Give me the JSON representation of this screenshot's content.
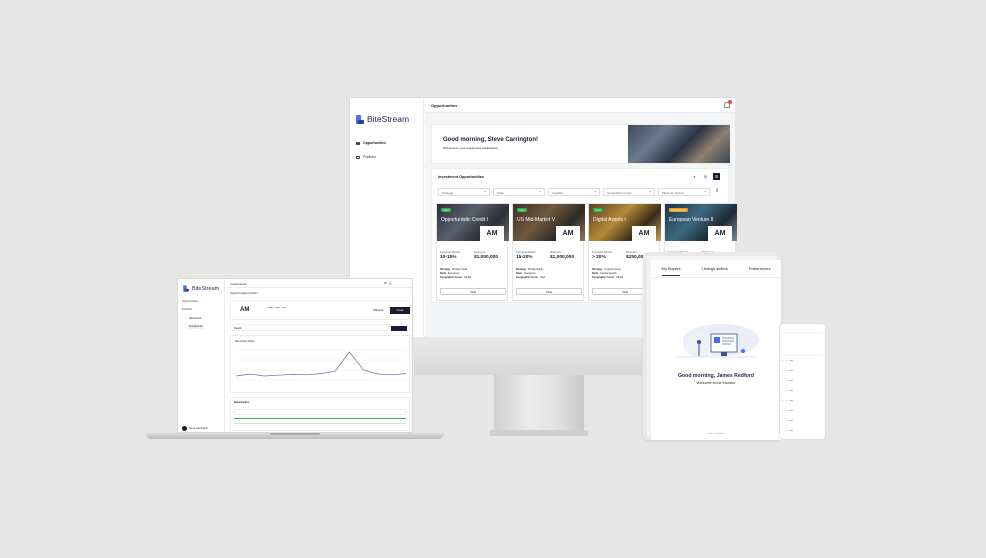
{
  "brand": {
    "name": "BiteStream",
    "accent": "#4a6cf7",
    "dark": "#1a1a2e"
  },
  "desktop": {
    "nav": [
      {
        "label": "Opportunities",
        "active": true
      },
      {
        "label": "Portfolio",
        "active": false
      }
    ],
    "topbar_title": "Opportunities",
    "hero": {
      "title": "Good morning, Steve Carrington!",
      "subtitle": "Welcome to your Investment marketplace"
    },
    "panel_title": "Investment Opportunities",
    "filters": [
      "Strategy",
      "Stats",
      "Liquidity",
      "Geographic Focus",
      "Minimum Return"
    ],
    "labels": {
      "projected_return": "Forecast Return",
      "minimum": "Minimum",
      "strategy": "Strategy",
      "stats": "Stats",
      "geo": "Geographic Focus"
    },
    "cards": [
      {
        "badge": "Open",
        "badge_color": "#2eaa4a",
        "title": "Opportunistic Credit I",
        "logo": "AM",
        "return": "10-15%",
        "minimum": "$1,000,000",
        "strategy": "Private Credit",
        "stats": "Evergreen",
        "geo": "Global",
        "button": "View",
        "img": "linear-gradient(135deg,#2a2f3a,#5a5f6c 40%,#2b2e36 70%,#6d6d6d)"
      },
      {
        "badge": "Open",
        "badge_color": "#2eaa4a",
        "title": "US Mid-Market V",
        "logo": "AM",
        "return": "15-20%",
        "minimum": "$1,000,000",
        "strategy": "Private Equity",
        "stats": "Evergreen",
        "geo": "USA",
        "button": "View",
        "img": "linear-gradient(135deg,#3b3026,#6e5840 40%,#2e2a24 70%,#8a7a66)"
      },
      {
        "badge": "Open",
        "badge_color": "#2eaa4a",
        "title": "Digital Assets I",
        "logo": "AM",
        "return": "> 20%",
        "minimum": "$250,000",
        "strategy": "Cryptocurrency",
        "stats": "Capital Growth",
        "geo": "Global",
        "button": "View",
        "img": "linear-gradient(135deg,#5a4020,#b58a3a 40%,#3a2a16 70%,#c9a255)"
      },
      {
        "badge": "Coming soon",
        "badge_color": "#e59a2a",
        "title": "European Venture II",
        "logo": "AM",
        "return": "",
        "minimum": "",
        "strategy": "",
        "stats": "",
        "geo": "",
        "button": "",
        "img": "linear-gradient(135deg,#1f3344,#3c6a80 40%,#1d2a36 70%,#7b8d96)"
      }
    ]
  },
  "laptop": {
    "nav": [
      "Opportunities",
      "Portfolio"
    ],
    "subnav": [
      "Dashboard",
      "Investments"
    ],
    "topbar_title": "Investments",
    "breadcrumb": "Opportunistic Credit I",
    "logo": "AM",
    "tab_label": "Details",
    "buttons": {
      "outline": "Withdraw",
      "dark": "Invest"
    },
    "chart_title": "Net Asset Value",
    "subscription_title": "Subscription",
    "user": "Steve Carrington",
    "chart_data": {
      "type": "line",
      "values": [
        3,
        3.5,
        3,
        3.2,
        3.4,
        3.3,
        3.6,
        4.2,
        9,
        4.5,
        3.5,
        3.3,
        3.6
      ]
    }
  },
  "tablet": {
    "tabs": [
      "My Buyers",
      "Listings sellers",
      "Preferences"
    ],
    "title": "Good morning, James Redford",
    "subtitle": "Welcome to the Investor"
  }
}
